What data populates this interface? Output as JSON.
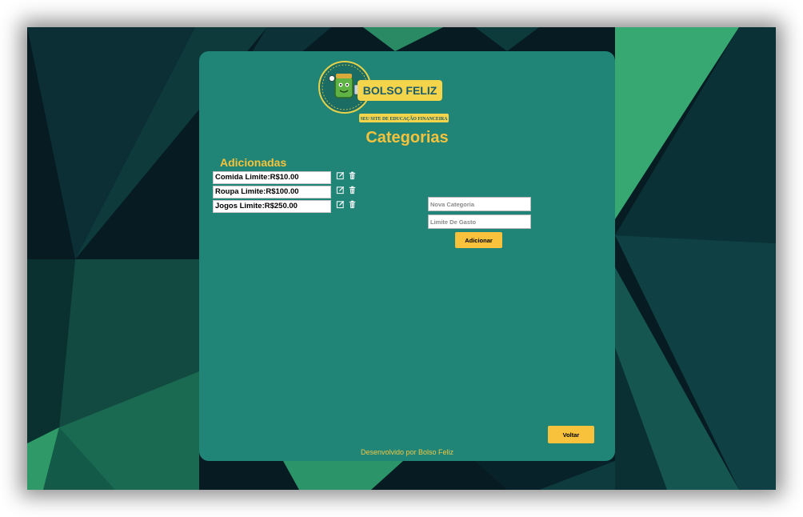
{
  "logo": {
    "brand_text": "BOLSO FELIZ",
    "tagline": "SEU SITE DE EDUCAÇÃO FINANCEIRA"
  },
  "page": {
    "title": "Categorias",
    "added_heading": "Adicionadas",
    "footer": "Desenvolvido por Bolso Feliz"
  },
  "categories": [
    {
      "label": "Comida Limite:R$10.00"
    },
    {
      "label": "Roupa Limite:R$100.00"
    },
    {
      "label": "Jogos Limite:R$250.00"
    }
  ],
  "form": {
    "category_placeholder": "Nova Categoria",
    "limit_placeholder": "Limite De Gasto",
    "add_label": "Adicionar"
  },
  "nav": {
    "back_label": "Voltar"
  },
  "icons": {
    "edit": "edit-icon",
    "delete": "trash-icon"
  },
  "colors": {
    "card": "#208577",
    "accent": "#f7c23c",
    "background": "#05141a"
  }
}
